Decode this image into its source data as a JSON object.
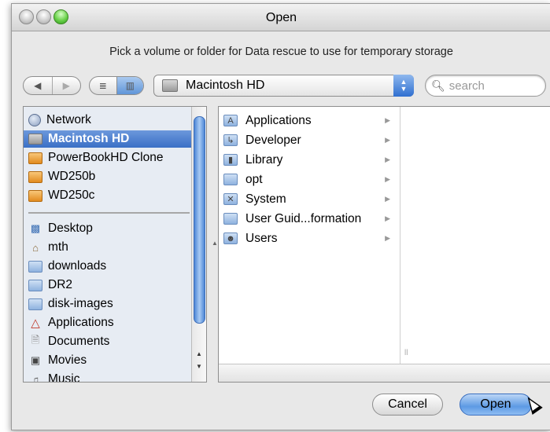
{
  "window": {
    "title": "Open"
  },
  "prompt": "Pick a volume or folder for Data rescue to use for temporary storage",
  "toolbar": {
    "back_glyph": "◀",
    "forward_glyph": "▶",
    "list_view_glyph": "≣",
    "column_view_glyph": "▥",
    "location": "Macintosh HD",
    "search_placeholder": "search"
  },
  "sidebar": {
    "devices": [
      {
        "label": "Network",
        "icon": "network-icon",
        "selected": false
      },
      {
        "label": "Macintosh HD",
        "icon": "hard-drive-icon",
        "selected": true
      },
      {
        "label": "PowerBookHD Clone",
        "icon": "external-drive-icon",
        "selected": false
      },
      {
        "label": "WD250b",
        "icon": "external-drive-icon",
        "selected": false
      },
      {
        "label": "WD250c",
        "icon": "external-drive-icon",
        "selected": false
      }
    ],
    "places": [
      {
        "label": "Desktop",
        "icon": "desktop-icon"
      },
      {
        "label": "mth",
        "icon": "home-icon"
      },
      {
        "label": "downloads",
        "icon": "folder-icon"
      },
      {
        "label": "DR2",
        "icon": "folder-icon"
      },
      {
        "label": "disk-images",
        "icon": "folder-icon"
      },
      {
        "label": "Applications",
        "icon": "applications-icon"
      },
      {
        "label": "Documents",
        "icon": "documents-icon"
      },
      {
        "label": "Movies",
        "icon": "movies-icon"
      },
      {
        "label": "Music",
        "icon": "music-icon"
      }
    ]
  },
  "browser": {
    "column1": [
      {
        "label": "Applications",
        "icon": "applications-folder-icon"
      },
      {
        "label": "Developer",
        "icon": "developer-folder-icon"
      },
      {
        "label": "Library",
        "icon": "library-folder-icon"
      },
      {
        "label": "opt",
        "icon": "folder-icon"
      },
      {
        "label": "System",
        "icon": "system-folder-icon"
      },
      {
        "label": "User Guid...formation",
        "icon": "folder-icon"
      },
      {
        "label": "Users",
        "icon": "users-folder-icon"
      }
    ],
    "column_resize_glyph": "ll"
  },
  "buttons": {
    "cancel": "Cancel",
    "open": "Open"
  },
  "colors": {
    "selection": "#3a6fc6",
    "accent_blue": "#5d9ae4"
  }
}
